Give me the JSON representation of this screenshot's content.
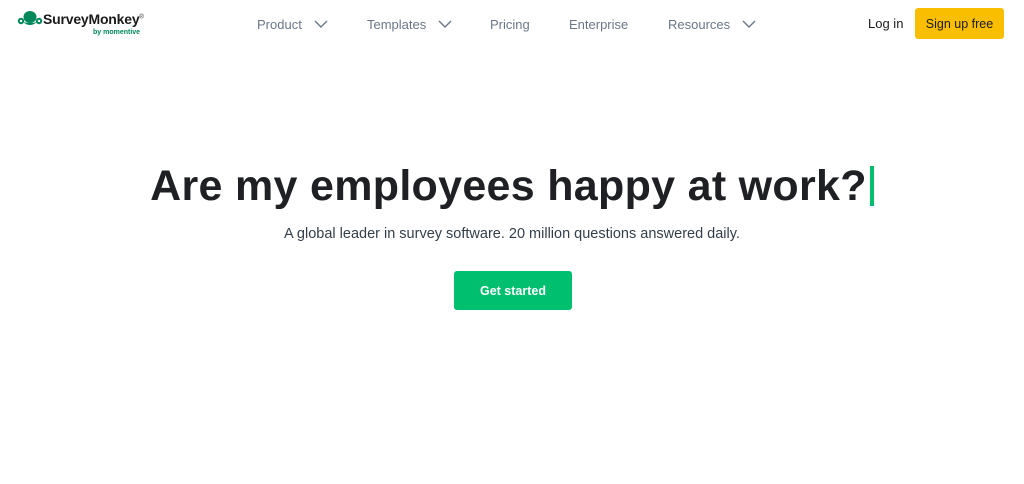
{
  "brand": {
    "name": "SurveyMonkey",
    "registered": "®",
    "tagline": "by momentive",
    "logo_icon": "monkey-logo-icon",
    "colors": {
      "accent_green": "#00bf6f",
      "tagline_green": "#00875a",
      "signup_yellow": "#f9be00",
      "nav_text": "#6b7787"
    }
  },
  "nav": {
    "items": [
      {
        "label": "Product",
        "has_dropdown": true
      },
      {
        "label": "Templates",
        "has_dropdown": true
      },
      {
        "label": "Pricing",
        "has_dropdown": false
      },
      {
        "label": "Enterprise",
        "has_dropdown": false
      },
      {
        "label": "Resources",
        "has_dropdown": true
      }
    ],
    "login_label": "Log in",
    "signup_label": "Sign up free"
  },
  "hero": {
    "title": "Are my employees happy at work?",
    "subtitle": "A global leader in survey software. 20 million questions answered daily.",
    "cta_label": "Get started"
  }
}
